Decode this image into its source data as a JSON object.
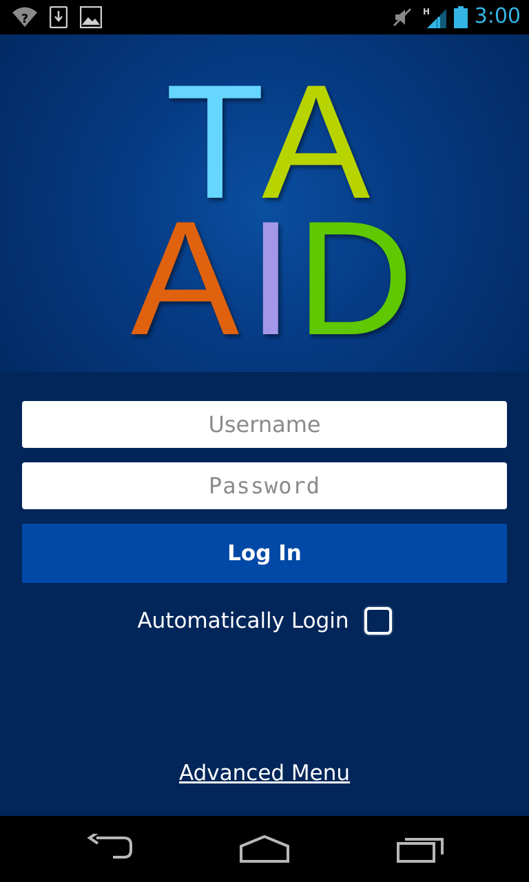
{
  "status_bar": {
    "icons": [
      "wifi-question-icon",
      "download-icon",
      "gallery-icon",
      "mute-icon",
      "signal-h-icon",
      "battery-icon"
    ],
    "network_type": "H",
    "clock": "3:00",
    "accent_color": "#33b5e5"
  },
  "logo": {
    "row1": [
      "T",
      "A"
    ],
    "row2": [
      "A",
      "I",
      "D"
    ],
    "colors": {
      "T": "#66d5ff",
      "A1": "#b8d400",
      "A2": "#e0620e",
      "I": "#a497e8",
      "D": "#5fc800"
    }
  },
  "form": {
    "username_placeholder": "Username",
    "password_placeholder": "Password",
    "login_label": "Log In",
    "auto_login_label": "Automatically Login",
    "auto_login_checked": false,
    "advanced_menu_label": "Advanced Menu"
  },
  "nav_bar": {
    "icons": [
      "back-icon",
      "home-icon",
      "recent-apps-icon"
    ]
  }
}
